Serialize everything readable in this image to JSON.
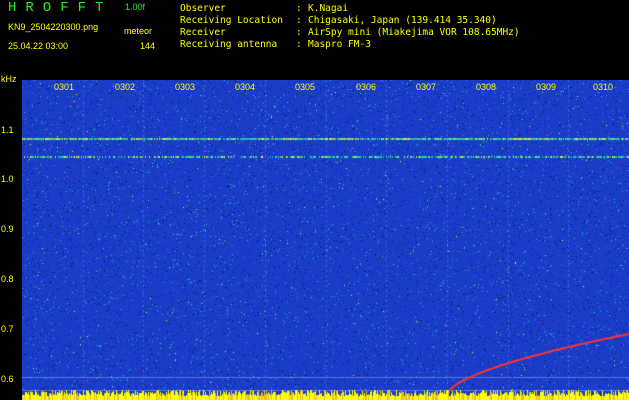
{
  "header": {
    "app_title": "HROFFT",
    "version": "1.00f",
    "filename": "KN9_2504220300.png",
    "meteor_label": "meteor",
    "datetime": "25.04.22 03:00",
    "meteor_count": "144"
  },
  "info": [
    {
      "label": "Observer",
      "value": "K.Nagai"
    },
    {
      "label": "Receiving Location",
      "value": "Chigasaki, Japan (139.414 35.340)"
    },
    {
      "label": "Receiver",
      "value": "AirSpy mini (Miakejima VOR 108.65MHz)"
    },
    {
      "label": "Receiving antenna",
      "value": "Maspro FM-3"
    }
  ],
  "separator": ":",
  "colors": {
    "background": "#000000",
    "label_yellow": "#ffff00",
    "title_green": "#22ee22",
    "waterfall_blue": "#1a3cc8",
    "trail_red": "#ff3030",
    "signal_yellow": "#ffff00"
  },
  "chart_data": {
    "type": "heatmap",
    "title": "",
    "ylabel": "kHz",
    "y_ticks": [
      "1.1",
      "1.0",
      "0.9",
      "0.8",
      "0.7",
      "0.6"
    ],
    "x_ticks": [
      "0301",
      "0302",
      "0303",
      "0304",
      "0305",
      "0306",
      "0307",
      "0308",
      "0309",
      "0310"
    ],
    "x_range": [
      "03:00",
      "03:10"
    ],
    "y_range": [
      0.57,
      1.2
    ],
    "carrier_lines_khz": [
      1.085,
      1.05
    ],
    "meteor_trail": {
      "start_time_min": 7.0,
      "end_time_min": 10.0,
      "start_khz": 0.58,
      "end_khz": 0.7
    }
  }
}
